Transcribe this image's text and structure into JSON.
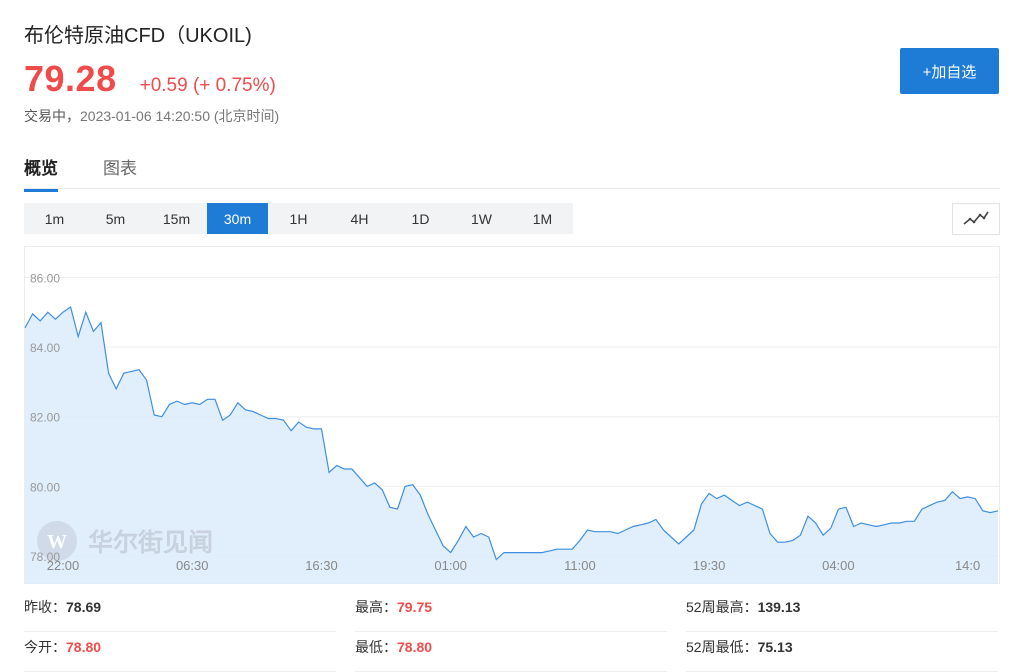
{
  "header": {
    "title": "布伦特原油CFD（UKOIL)",
    "price": "79.28",
    "change": "+0.59 (+ 0.75%)",
    "status": "交易中，",
    "timestamp": "2023-01-06 14:20:50",
    "timezone": "(北京时间)",
    "add_button": "+加自选"
  },
  "tabs": [
    {
      "label": "概览",
      "active": true
    },
    {
      "label": "图表",
      "active": false
    }
  ],
  "ranges": [
    "1m",
    "5m",
    "15m",
    "30m",
    "1H",
    "4H",
    "1D",
    "1W",
    "1M"
  ],
  "active_range": "30m",
  "watermark": "华尔街见闻",
  "colors": {
    "accent": "#1f7cd6",
    "up": "#f04b4b",
    "line": "#3f8fe0",
    "fill": "#dcebfb"
  },
  "icons": {
    "chart_type": "line-chart-icon",
    "watermark_logo": "wallstreetcn-logo-icon"
  },
  "stats": [
    [
      {
        "label": "昨收：",
        "value": "78.69",
        "red": false
      },
      {
        "label": "最高：",
        "value": "79.75",
        "red": true
      },
      {
        "label": "52周最高：",
        "value": "139.13",
        "red": false
      }
    ],
    [
      {
        "label": "今开：",
        "value": "78.80",
        "red": true
      },
      {
        "label": "最低：",
        "value": "78.80",
        "red": true
      },
      {
        "label": "52周最低：",
        "value": "75.13",
        "red": false
      }
    ]
  ],
  "chart_data": {
    "type": "area",
    "title": "",
    "xlabel": "",
    "ylabel": "",
    "ylim": [
      77.2,
      86.9
    ],
    "yticks": [
      "86.00",
      "84.00",
      "82.00",
      "80.00",
      "78.00"
    ],
    "xticks": [
      {
        "label": "22:00",
        "i": 5
      },
      {
        "label": "06:30",
        "i": 22
      },
      {
        "label": "16:30",
        "i": 39
      },
      {
        "label": "01:00",
        "i": 56
      },
      {
        "label": "11:00",
        "i": 73
      },
      {
        "label": "19:30",
        "i": 90
      },
      {
        "label": "04:00",
        "i": 107
      },
      {
        "label": "14:0",
        "i": 124
      }
    ],
    "grid": true,
    "values": [
      84.55,
      84.95,
      84.75,
      85.0,
      84.8,
      85.0,
      85.15,
      84.3,
      85.0,
      84.45,
      84.7,
      83.25,
      82.8,
      83.25,
      83.3,
      83.35,
      83.05,
      82.05,
      82.0,
      82.35,
      82.45,
      82.35,
      82.4,
      82.35,
      82.5,
      82.5,
      81.9,
      82.05,
      82.4,
      82.2,
      82.15,
      82.05,
      81.95,
      81.95,
      81.9,
      81.6,
      81.85,
      81.7,
      81.65,
      81.65,
      80.4,
      80.6,
      80.5,
      80.5,
      80.25,
      80.0,
      80.1,
      79.9,
      79.4,
      79.35,
      80.0,
      80.05,
      79.75,
      79.2,
      78.75,
      78.3,
      78.1,
      78.45,
      78.85,
      78.55,
      78.65,
      78.55,
      77.9,
      78.1,
      78.1,
      78.1,
      78.1,
      78.1,
      78.1,
      78.15,
      78.2,
      78.2,
      78.2,
      78.45,
      78.75,
      78.7,
      78.7,
      78.7,
      78.65,
      78.75,
      78.85,
      78.9,
      78.95,
      79.05,
      78.75,
      78.55,
      78.35,
      78.55,
      78.75,
      79.5,
      79.8,
      79.65,
      79.75,
      79.6,
      79.45,
      79.55,
      79.45,
      79.35,
      78.65,
      78.4,
      78.4,
      78.45,
      78.6,
      79.15,
      78.95,
      78.6,
      78.8,
      79.35,
      79.4,
      78.85,
      78.95,
      78.9,
      78.85,
      78.9,
      78.95,
      78.95,
      79.0,
      79.0,
      79.35,
      79.45,
      79.55,
      79.6,
      79.85,
      79.65,
      79.7,
      79.65,
      79.3,
      79.25,
      79.3
    ]
  }
}
